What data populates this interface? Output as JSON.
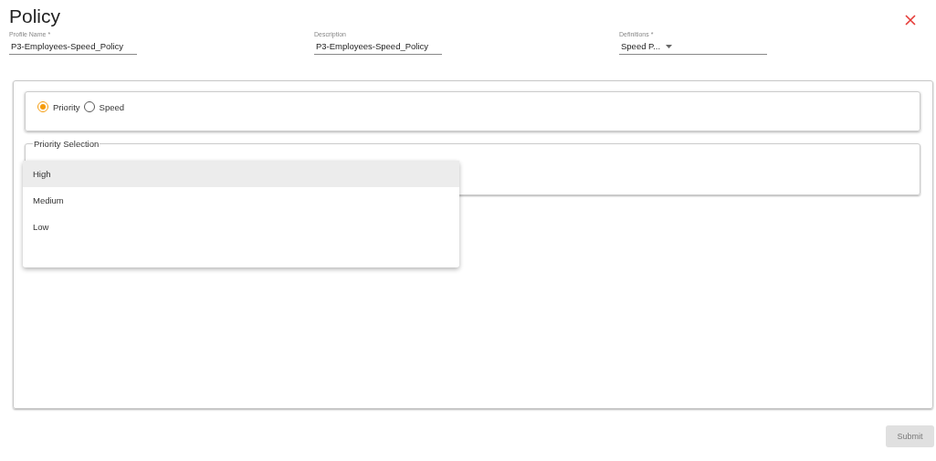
{
  "title": "Policy",
  "fields": [
    {
      "label": "Profile Name *",
      "value": "P3-Employees-Speed_Policy",
      "kind": "text"
    },
    {
      "label": "Description",
      "value": "P3-Employees-Speed_Policy",
      "kind": "text"
    },
    {
      "label": "Definitions *",
      "value": "Speed P...",
      "kind": "select"
    }
  ],
  "mode_options": [
    {
      "label": "Priority",
      "selected": true
    },
    {
      "label": "Speed",
      "selected": false
    }
  ],
  "priority_selection": {
    "legend": "Priority Selection",
    "menu": [
      {
        "label": "High",
        "selected": true
      },
      {
        "label": "Medium",
        "selected": false
      },
      {
        "label": "Low",
        "selected": false
      }
    ]
  },
  "submit": {
    "label": "Submit",
    "disabled": true
  }
}
